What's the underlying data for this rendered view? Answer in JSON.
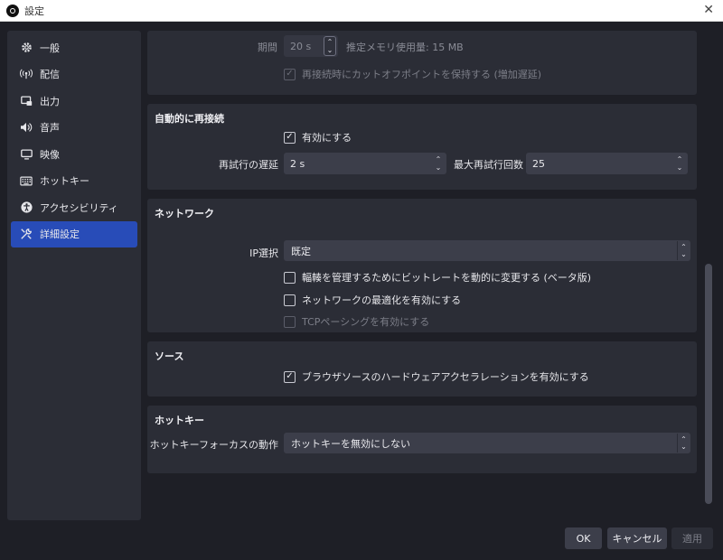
{
  "window": {
    "title": "設定"
  },
  "sidebar": {
    "items": [
      {
        "label": "一般",
        "icon": "gear-icon"
      },
      {
        "label": "配信",
        "icon": "antenna-icon"
      },
      {
        "label": "出力",
        "icon": "output-icon"
      },
      {
        "label": "音声",
        "icon": "speaker-icon"
      },
      {
        "label": "映像",
        "icon": "monitor-icon"
      },
      {
        "label": "ホットキー",
        "icon": "keyboard-icon"
      },
      {
        "label": "アクセシビリティ",
        "icon": "accessibility-icon"
      },
      {
        "label": "詳細設定",
        "icon": "tools-icon",
        "active": true
      }
    ]
  },
  "replay": {
    "duration_label": "期間",
    "duration_value": "20 s",
    "memory_note": "推定メモリ使用量: 15 MB",
    "keep_cutoff_label": "再接続時にカットオフポイントを保持する (増加遅延)",
    "keep_cutoff_checked": true
  },
  "reconnect": {
    "title": "自動的に再接続",
    "enable_label": "有効にする",
    "enable_checked": true,
    "retry_delay_label": "再試行の遅延",
    "retry_delay_value": "2 s",
    "max_retries_label": "最大再試行回数",
    "max_retries_value": "25"
  },
  "network": {
    "title": "ネットワーク",
    "ip_label": "IP選択",
    "ip_value": "既定",
    "dynamic_bitrate_label": "輻輳を管理するためにビットレートを動的に変更する (ベータ版)",
    "dynamic_bitrate_checked": false,
    "optimize_label": "ネットワークの最適化を有効にする",
    "optimize_checked": false,
    "tcp_pacing_label": "TCPペーシングを有効にする",
    "tcp_pacing_checked": false
  },
  "sources": {
    "title": "ソース",
    "browser_hw_label": "ブラウザソースのハードウェアアクセラレーションを有効にする",
    "browser_hw_checked": true
  },
  "hotkeys": {
    "title": "ホットキー",
    "focus_label": "ホットキーフォーカスの動作",
    "focus_value": "ホットキーを無効にしない"
  },
  "buttons": {
    "ok": "OK",
    "cancel": "キャンセル",
    "apply": "適用"
  },
  "glyphs": {
    "close": "✕",
    "check": "✓",
    "up": "▲",
    "down": "▼"
  }
}
